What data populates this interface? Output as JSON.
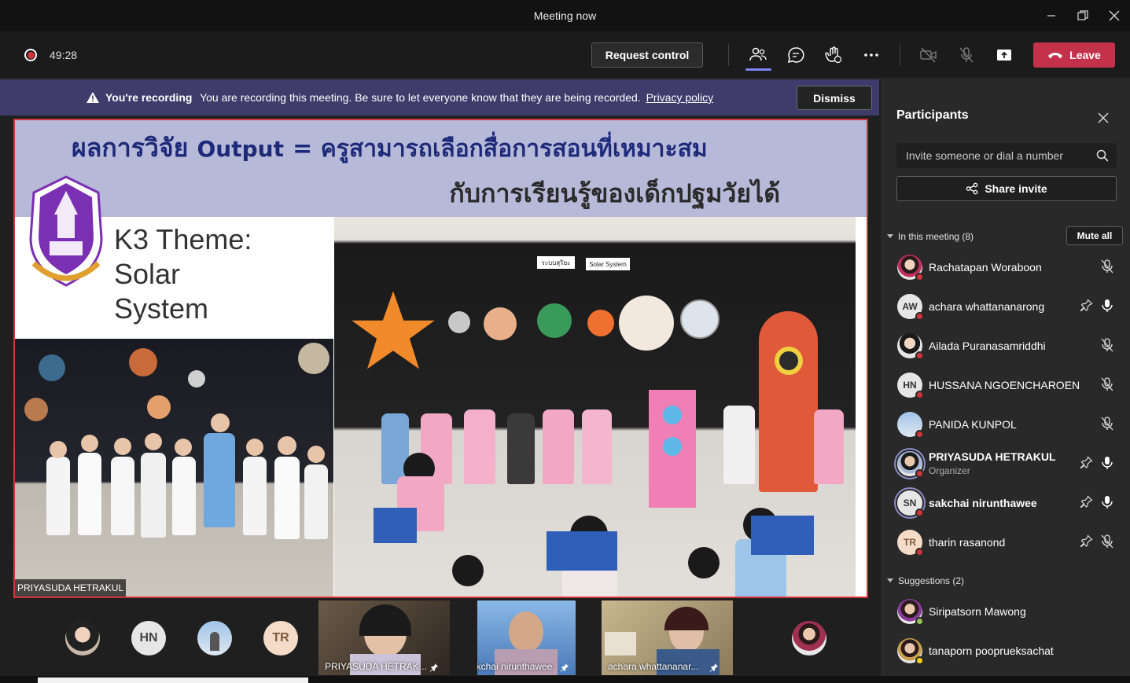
{
  "window": {
    "title": "Meeting now"
  },
  "toolbar": {
    "timer": "49:28",
    "request_control": "Request control",
    "leave": "Leave"
  },
  "banner": {
    "title": "You're recording",
    "message": "You are recording this meeting. Be sure to let everyone know that they are being recorded.",
    "link": "Privacy policy",
    "dismiss": "Dismiss"
  },
  "slide": {
    "title_thai": "ผลการวิจัย",
    "title_output": "Output",
    "title_rest": "= ครูสามารถเลือกสื่อการสอนที่เหมาะสม",
    "subtitle": "กับการเรียนรู้ของเด็กปฐมวัยได้",
    "theme_line1": "K3 Theme:",
    "theme_line2": "Solar",
    "theme_line3": "System",
    "poster1": "ระบบสุริยะ",
    "poster2": "Solar System",
    "presenter": "PRIYASUDA HETRAKUL"
  },
  "strip": {
    "avatars": [
      {
        "initials": "HN",
        "color": "#e6e6e6"
      },
      {
        "initials": "TR",
        "color": "#f5dcc8"
      }
    ],
    "videos": [
      {
        "name": "PRIYASUDA HETRAK..."
      },
      {
        "name": "sakchai nirunthawee"
      },
      {
        "name": "achara whattananar..."
      }
    ]
  },
  "participants": {
    "title": "Participants",
    "invite_placeholder": "Invite someone or dial a number",
    "share_invite": "Share invite",
    "in_meeting_label": "In this meeting (8)",
    "mute_all": "Mute all",
    "people": [
      {
        "name": "Rachatapan Woraboon",
        "initials": "",
        "role": "",
        "pinned": false,
        "muted": true
      },
      {
        "name": "achara whattananarong",
        "initials": "AW",
        "role": "",
        "pinned": true,
        "muted": false
      },
      {
        "name": "Ailada Puranasamriddhi",
        "initials": "",
        "role": "",
        "pinned": false,
        "muted": true
      },
      {
        "name": "HUSSANA NGOENCHAROEN",
        "initials": "HN",
        "role": "",
        "pinned": false,
        "muted": true
      },
      {
        "name": "PANIDA KUNPOL",
        "initials": "",
        "role": "",
        "pinned": false,
        "muted": true
      },
      {
        "name": "PRIYASUDA HETRAKUL",
        "initials": "",
        "role": "Organizer",
        "pinned": true,
        "muted": false
      },
      {
        "name": "sakchai nirunthawee",
        "initials": "SN",
        "role": "",
        "pinned": true,
        "muted": false
      },
      {
        "name": "tharin rasanond",
        "initials": "TR",
        "role": "",
        "pinned": true,
        "muted": true
      }
    ],
    "suggestions_label": "Suggestions (2)",
    "suggestions": [
      {
        "name": "Siripatsorn Mawong"
      },
      {
        "name": "tanaporn pooprueksachat"
      }
    ]
  },
  "colors": {
    "leave": "#c4314b",
    "banner": "#3f3b6b",
    "accent": "#6264a7",
    "record": "#d13438"
  }
}
